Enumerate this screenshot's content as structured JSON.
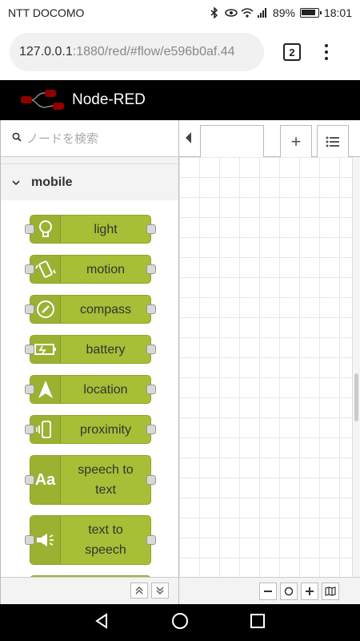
{
  "status": {
    "carrier": "NTT DOCOMO",
    "battery": "89%",
    "time": "18:01"
  },
  "browser": {
    "url_host": "127.0.0.1",
    "url_rest": ":1880/red/#flow/e596b0af.44",
    "tab_count": "2"
  },
  "app": {
    "title": "Node-RED"
  },
  "palette": {
    "search_placeholder": "ノードを検索",
    "category": "mobile",
    "nodes": [
      {
        "label": "light",
        "icon": "lightbulb-icon"
      },
      {
        "label": "motion",
        "icon": "phone-shake-icon"
      },
      {
        "label": "compass",
        "icon": "compass-icon"
      },
      {
        "label": "battery",
        "icon": "battery-icon"
      },
      {
        "label": "location",
        "icon": "location-arrow-icon"
      },
      {
        "label": "proximity",
        "icon": "proximity-icon"
      },
      {
        "label": "speech to text",
        "icon": "text-aa-icon"
      },
      {
        "label": "text to speech",
        "icon": "megaphone-icon"
      }
    ]
  },
  "colors": {
    "node": "#a6bf36",
    "header": "#000000"
  }
}
